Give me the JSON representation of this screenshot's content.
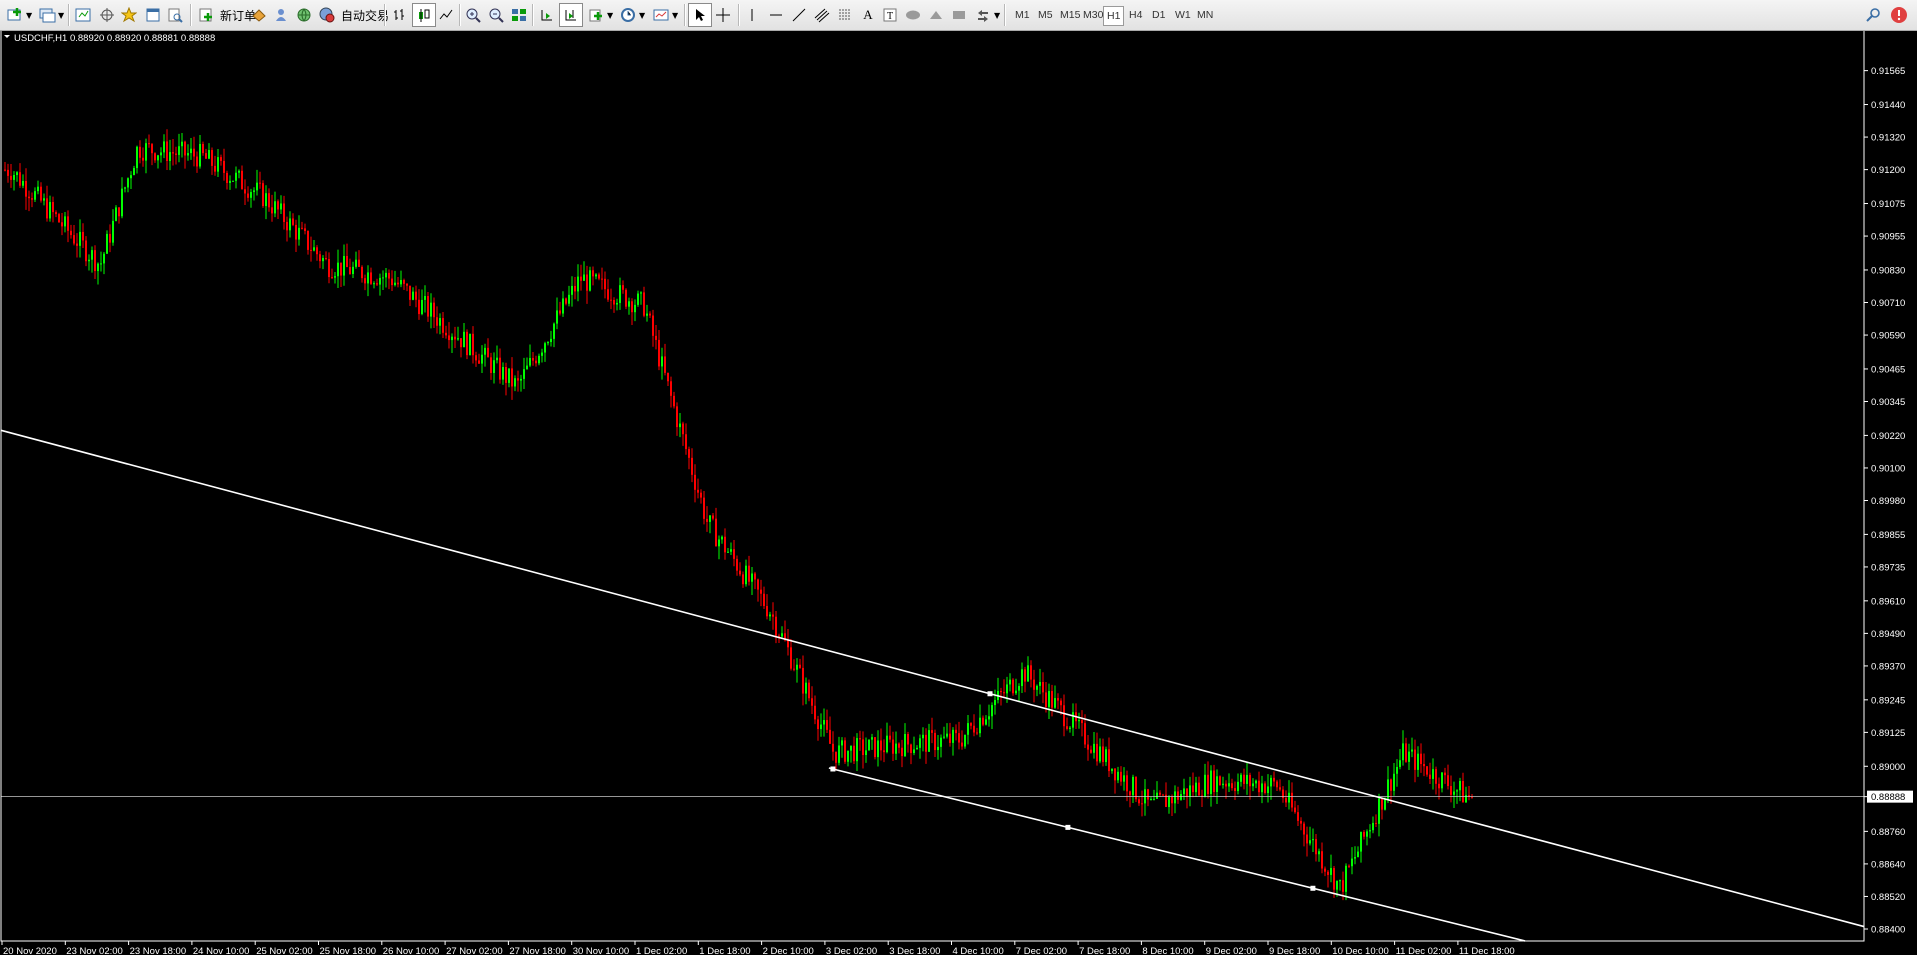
{
  "toolbar": {
    "new_order_label": "新订单",
    "auto_trading_label": "自动交易",
    "timeframes": [
      "M1",
      "M5",
      "M15",
      "M30",
      "H1",
      "H4",
      "D1",
      "W1",
      "MN"
    ],
    "active_timeframe": "H1"
  },
  "chart_header": {
    "symbol_info": "USDCHF,H1  0.88920 0.88920 0.88881 0.88888"
  },
  "chart_data": {
    "type": "candlestick",
    "symbol": "USDCHF",
    "timeframe": "H1",
    "bid": 0.88888,
    "ohlc_last": {
      "open": 0.8892,
      "high": 0.8892,
      "low": 0.88881,
      "close": 0.88888
    },
    "y_ticks": [
      "0.91565",
      "0.91440",
      "0.91320",
      "0.91200",
      "0.91075",
      "0.90955",
      "0.90830",
      "0.90710",
      "0.90590",
      "0.90465",
      "0.90345",
      "0.90220",
      "0.90100",
      "0.89980",
      "0.89855",
      "0.89735",
      "0.89610",
      "0.89490",
      "0.89370",
      "0.89245",
      "0.89125",
      "0.89000",
      "0.88888",
      "0.88760",
      "0.88640",
      "0.88520",
      "0.88400"
    ],
    "ylim": [
      0.884,
      0.9163
    ],
    "x_ticks": [
      "20 Nov 2020",
      "23 Nov 02:00",
      "23 Nov 18:00",
      "24 Nov 10:00",
      "25 Nov 02:00",
      "25 Nov 18:00",
      "26 Nov 10:00",
      "27 Nov 02:00",
      "27 Nov 18:00",
      "30 Nov 10:00",
      "1 Dec 02:00",
      "1 Dec 18:00",
      "2 Dec 10:00",
      "3 Dec 02:00",
      "3 Dec 18:00",
      "4 Dec 10:00",
      "7 Dec 02:00",
      "7 Dec 18:00",
      "8 Dec 10:00",
      "9 Dec 02:00",
      "9 Dec 18:00",
      "10 Dec 10:00",
      "11 Dec 02:00",
      "11 Dec 18:00"
    ],
    "close_path": [
      [
        "20 Nov 2020",
        0.912
      ],
      [
        "23 Nov 02:00",
        0.9095
      ],
      [
        "23 Nov 02:00",
        0.9085
      ],
      [
        "23 Nov 18:00",
        0.9128
      ],
      [
        "24 Nov 10:00",
        0.9125
      ],
      [
        "25 Nov 02:00",
        0.911
      ],
      [
        "25 Nov 18:00",
        0.9085
      ],
      [
        "26 Nov 10:00",
        0.908
      ],
      [
        "27 Nov 02:00",
        0.906
      ],
      [
        "27 Nov 18:00",
        0.904
      ],
      [
        "30 Nov 10:00",
        0.908
      ],
      [
        "1 Dec 02:00",
        0.907
      ],
      [
        "1 Dec 18:00",
        0.899
      ],
      [
        "2 Dec 10:00",
        0.8957
      ],
      [
        "3 Dec 02:00",
        0.8905
      ],
      [
        "3 Dec 18:00",
        0.8908
      ],
      [
        "4 Dec 10:00",
        0.891
      ],
      [
        "7 Dec 02:00",
        0.8935
      ],
      [
        "7 Dec 18:00",
        0.891
      ],
      [
        "8 Dec 10:00",
        0.8885
      ],
      [
        "9 Dec 02:00",
        0.8895
      ],
      [
        "9 Dec 18:00",
        0.8893
      ],
      [
        "10 Dec 10:00",
        0.8855
      ],
      [
        "11 Dec 02:00",
        0.8905
      ],
      [
        "11 Dec 18:00",
        0.88888
      ]
    ],
    "trendlines": [
      {
        "name": "upper-channel-line",
        "from": [
          "20 Nov 2020",
          0.9023
        ],
        "to": [
          "11 Dec 18:00",
          0.888
        ]
      },
      {
        "name": "lower-channel-line",
        "from": [
          "3 Dec 02:00",
          0.8899
        ],
        "to": [
          "11 Dec 18:00",
          0.8841
        ]
      }
    ],
    "colors": {
      "up": "#00ff00",
      "down": "#ff0000",
      "background": "#000000",
      "axis_text": "#ffffff",
      "lines": "#ffffff"
    }
  }
}
